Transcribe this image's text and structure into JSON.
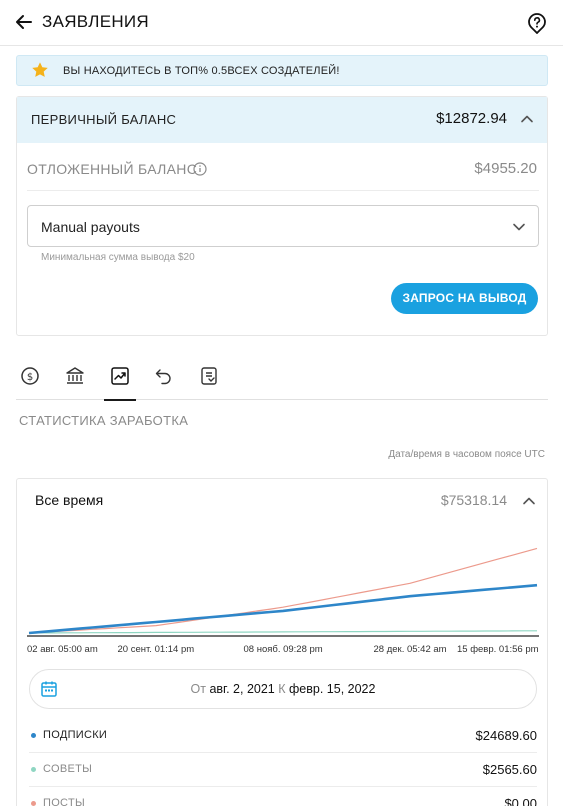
{
  "header": {
    "title": "ЗАЯВЛЕНИЯ",
    "back_icon": "arrow-left-icon",
    "help_icon": "help-bubble-icon"
  },
  "banner": {
    "text": "ВЫ НАХОДИТЕСЬ В ТОП% 0.5ВСЕХ СОЗДАТЕЛЕЙ!",
    "icon": "star-icon",
    "icon_color": "#f5b21a"
  },
  "balance": {
    "primary_label": "ПЕРВИЧНЫЙ БАЛАНС",
    "primary_amount": "$12872.94",
    "deferred_label": "ОТЛОЖЕННЫЙ БАЛАНС",
    "deferred_amount": "$4955.20",
    "payout_selected": "Manual payouts",
    "min_hint": "Минимальная сумма вывода $20",
    "withdraw_label": "ЗАПРОС НА ВЫВОД"
  },
  "tabs": [
    {
      "icon": "dollar-circle-icon",
      "active": false
    },
    {
      "icon": "bank-icon",
      "active": false
    },
    {
      "icon": "chart-trend-icon",
      "active": true
    },
    {
      "icon": "undo-icon",
      "active": false
    },
    {
      "icon": "statement-icon",
      "active": false
    }
  ],
  "stats": {
    "title": "СТАТИСТИКА ЗАРАБОТКА",
    "tz_note": "Дата/время в часовом поясе UTC",
    "period": "Все время",
    "total": "$75318.14",
    "range_from_label": "От",
    "range_from": "авг. 2, 2021",
    "range_to_label": "К",
    "range_to": "февр. 15, 2022"
  },
  "chart_data": {
    "type": "line",
    "x": [
      "02 авг. 05:00 am",
      "20 сент. 01:14 pm",
      "08 нояб. 09:28 pm",
      "28 дек. 05:42 am",
      "15 февр. 01:56 pm"
    ],
    "series": [
      {
        "name": "ПОДПИСКИ",
        "color": "#2e86c9",
        "values": [
          0,
          6,
          12,
          20,
          26
        ]
      },
      {
        "name": "СОВЕТЫ",
        "color": "#8fd6c2",
        "values": [
          0,
          0.3,
          0.6,
          0.9,
          1.2
        ]
      },
      {
        "name": "ПОСТЫ",
        "color": "#ec9a8c",
        "values": [
          0,
          4,
          14,
          27,
          46
        ]
      }
    ],
    "ylim": [
      0,
      50
    ],
    "grid": false
  },
  "legend": [
    {
      "name": "ПОДПИСКИ",
      "value": "$24689.60",
      "color": "#2e86c9",
      "text_color": "#222"
    },
    {
      "name": "СОВЕТЫ",
      "value": "$2565.60",
      "color": "#8fd6c2",
      "text_color": "#8a8a8a"
    },
    {
      "name": "ПОСТЫ",
      "value": "$0.00",
      "color": "#ec9a8c",
      "text_color": "#8a8a8a"
    }
  ]
}
